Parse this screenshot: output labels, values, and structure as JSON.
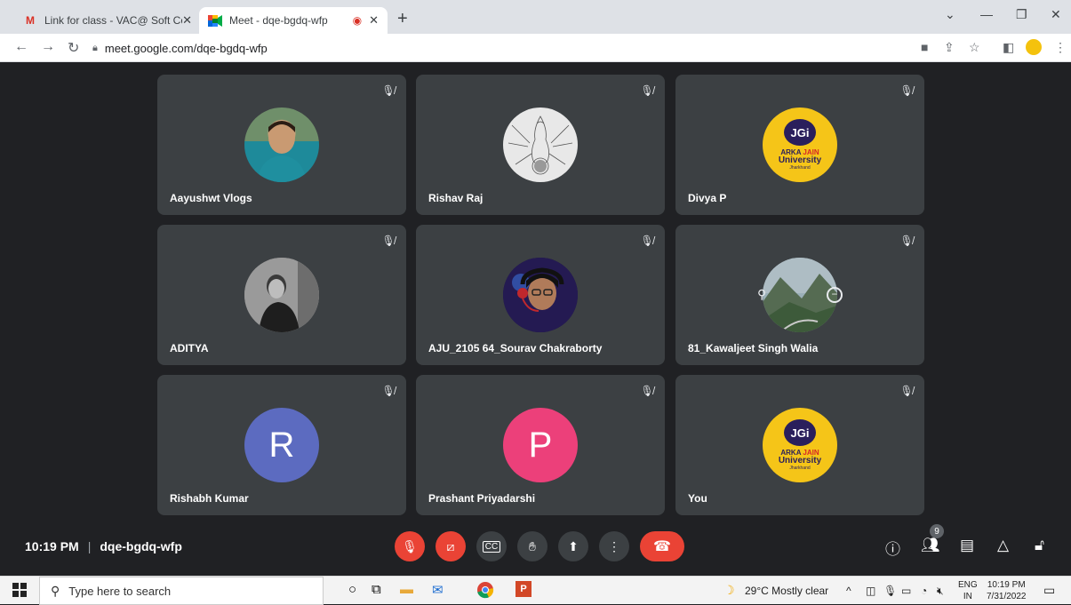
{
  "browser": {
    "tabs": [
      {
        "title": "Link for class - VAC@ Soft Comp",
        "icon": "gmail-icon"
      },
      {
        "title": "Meet - dqe-bgdq-wfp",
        "icon": "meet-icon"
      }
    ],
    "url": "meet.google.com/dqe-bgdq-wfp"
  },
  "participants": [
    {
      "name": "Aayushwt Vlogs",
      "avatar": "photo"
    },
    {
      "name": "Rishav Raj",
      "avatar": "sketch"
    },
    {
      "name": "Divya P",
      "avatar": "jgi"
    },
    {
      "name": "ADITYA",
      "avatar": "photo"
    },
    {
      "name": "AJU_2105 64_Sourav Chakraborty",
      "avatar": "photo"
    },
    {
      "name": "81_Kawaljeet Singh Walia",
      "avatar": "landscape"
    },
    {
      "name": "Rishabh Kumar",
      "avatar_letter": "R",
      "avatar_color": "#5c6bc0"
    },
    {
      "name": "Prashant Priyadarshi",
      "avatar_letter": "P",
      "avatar_color": "#ec407a"
    },
    {
      "name": "You",
      "avatar": "jgi"
    }
  ],
  "jgi_logo": {
    "mark": "JGi",
    "line1a": "ARKA ",
    "line1b": "JAIN",
    "line2": "University",
    "line3": "Jharkhand"
  },
  "meeting": {
    "time": "10:19 PM",
    "separator": "|",
    "code": "dqe-bgdq-wfp",
    "participant_count": "9"
  },
  "taskbar": {
    "search_placeholder": "Type here to search",
    "weather": "29°C  Mostly clear",
    "lang_line1": "ENG",
    "lang_line2": "IN",
    "clock_time": "10:19 PM",
    "clock_date": "7/31/2022"
  },
  "colors": {
    "meet_bg": "#202124",
    "tile_bg": "#3c4043",
    "danger": "#ea4335"
  }
}
